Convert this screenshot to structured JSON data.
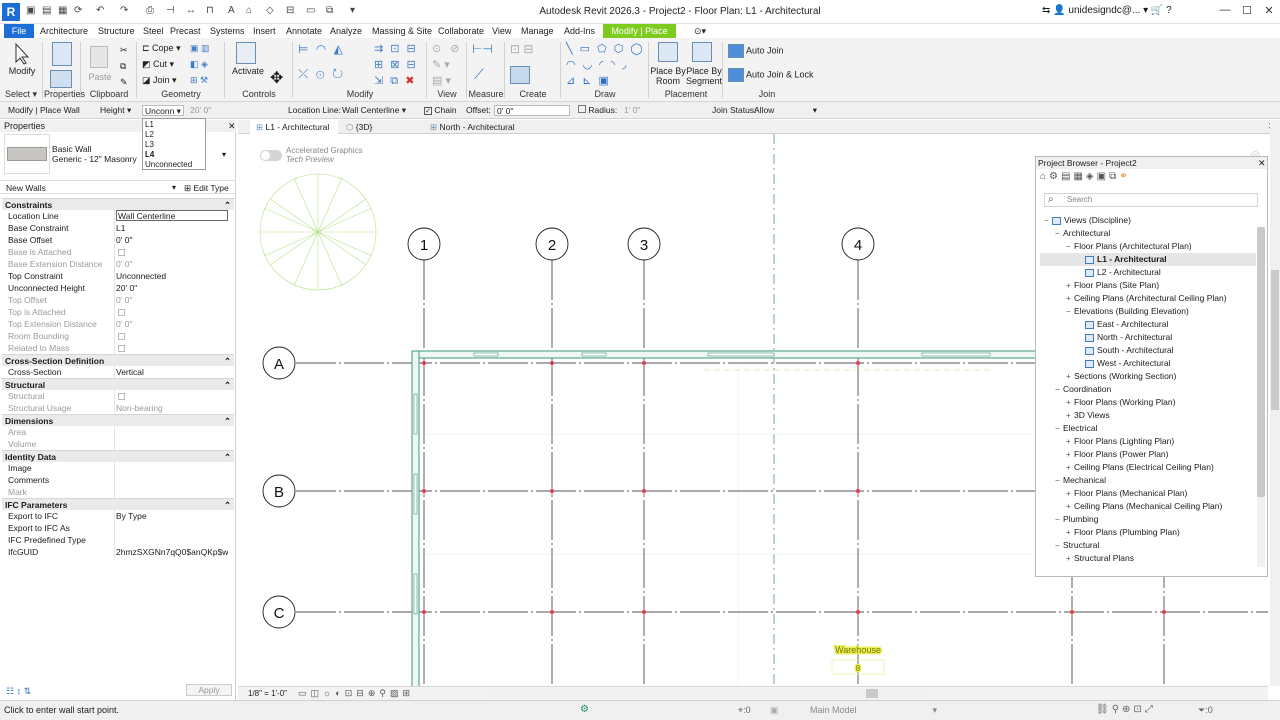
{
  "titlebar": {
    "logo": "R",
    "title": "Autodesk Revit 2026.3 - Project2 - Floor Plan: L1 - Architectural",
    "user": "unidesigndc@...",
    "help": "?"
  },
  "menu": {
    "file": "File",
    "tabs": [
      "Architecture",
      "Structure",
      "Steel",
      "Precast",
      "Systems",
      "Insert",
      "Annotate",
      "Analyze",
      "Massing & Site",
      "Collaborate",
      "View",
      "Manage",
      "Add-Ins"
    ],
    "context_tab": "Modify | Place Wall"
  },
  "ribbon": {
    "modify": "Modify",
    "paste": "Paste",
    "cope": "Cope",
    "cut": "Cut",
    "join": "Join",
    "activate": "Activate",
    "place_by_room": "Place By Room",
    "place_by_segment": "Place By Segment",
    "auto_join": "Auto Join",
    "auto_join_lock": "Auto Join & Lock",
    "panels": [
      "Select ▾",
      "Properties",
      "Clipboard",
      "Geometry",
      "Controls",
      "Modify",
      "View",
      "Measure",
      "Create",
      "Draw",
      "Placement",
      "Join"
    ]
  },
  "options_bar": {
    "context": "Modify | Place Wall",
    "height_mode": "Height",
    "height_target": "Unconn",
    "height_value": "20'  0\"",
    "location_line_label": "Location Line:",
    "location_line_value": "Wall Centerline",
    "chain": "Chain",
    "offset_label": "Offset:",
    "offset_value": "0'  0\"",
    "radius": "Radius:",
    "radius_value": "1'  0\"",
    "join_status_label": "Join Status:",
    "join_status_value": "Allow"
  },
  "dropdown": {
    "options": [
      "L1",
      "L2",
      "L3",
      "L4",
      "Unconnected"
    ],
    "selected": "L4"
  },
  "properties": {
    "header": "Properties",
    "type_family": "Basic Wall",
    "type_name": "Generic - 12\" Masonry",
    "instance_filter": "New Walls",
    "edit_type": "Edit Type",
    "apply": "Apply",
    "groups": [
      {
        "title": "Constraints",
        "rows": [
          {
            "name": "Location Line",
            "value": "Wall Centerline",
            "disabled": false
          },
          {
            "name": "Base Constraint",
            "value": "L1",
            "disabled": false
          },
          {
            "name": "Base Offset",
            "value": "0'  0\"",
            "disabled": false
          },
          {
            "name": "Base is Attached",
            "value": "",
            "disabled": true
          },
          {
            "name": "Base Extension Distance",
            "value": "0'  0\"",
            "disabled": true
          },
          {
            "name": "Top Constraint",
            "value": "Unconnected",
            "disabled": false
          },
          {
            "name": "Unconnected Height",
            "value": "20'  0\"",
            "disabled": false
          },
          {
            "name": "Top Offset",
            "value": "0'  0\"",
            "disabled": true
          },
          {
            "name": "Top is Attached",
            "value": "",
            "disabled": true
          },
          {
            "name": "Top Extension Distance",
            "value": "0'  0\"",
            "disabled": true
          },
          {
            "name": "Room Bounding",
            "value": "",
            "disabled": true
          },
          {
            "name": "Related to Mass",
            "value": "",
            "disabled": true
          }
        ]
      },
      {
        "title": "Cross-Section Definition",
        "rows": [
          {
            "name": "Cross-Section",
            "value": "Vertical",
            "disabled": false
          }
        ]
      },
      {
        "title": "Structural",
        "rows": [
          {
            "name": "Structural",
            "value": "",
            "disabled": true
          },
          {
            "name": "Structural Usage",
            "value": "Non-bearing",
            "disabled": true
          }
        ]
      },
      {
        "title": "Dimensions",
        "rows": [
          {
            "name": "Area",
            "value": "",
            "disabled": true
          },
          {
            "name": "Volume",
            "value": "",
            "disabled": true
          }
        ]
      },
      {
        "title": "Identity Data",
        "rows": [
          {
            "name": "Image",
            "value": "",
            "disabled": false
          },
          {
            "name": "Comments",
            "value": "",
            "disabled": false
          },
          {
            "name": "Mark",
            "value": "",
            "disabled": true
          }
        ]
      },
      {
        "title": "IFC Parameters",
        "rows": [
          {
            "name": "Export to IFC",
            "value": "By Type",
            "disabled": false
          },
          {
            "name": "Export to IFC As",
            "value": "",
            "disabled": false
          },
          {
            "name": "IFC Predefined Type",
            "value": "",
            "disabled": false
          },
          {
            "name": "IfcGUID",
            "value": "2hmzSXGNn7qQ0$anQKp$wb",
            "disabled": false
          }
        ]
      }
    ]
  },
  "view_tabs": [
    {
      "label": "L1 - Architectural",
      "active": true
    },
    {
      "label": "{3D}",
      "active": false
    },
    {
      "label": "North - Architectural",
      "active": false
    }
  ],
  "canvas": {
    "accel_title": "Accelerated Graphics",
    "accel_sub": "Tech Preview",
    "grid_numbers": [
      "1",
      "2",
      "3",
      "4"
    ],
    "grid_letters": [
      "A",
      "B",
      "C"
    ],
    "room_label": "Warehouse",
    "room_number": "8"
  },
  "project_browser": {
    "title": "Project Browser - Project2",
    "search_placeholder": "Search",
    "items": [
      {
        "label": "Views (Discipline)",
        "level": 0,
        "exp": "−",
        "icon": true,
        "sel": false
      },
      {
        "label": "Architectural",
        "level": 1,
        "exp": "−",
        "icon": false,
        "sel": false
      },
      {
        "label": "Floor Plans (Architectural Plan)",
        "level": 2,
        "exp": "−",
        "icon": false,
        "sel": false
      },
      {
        "label": "L1 - Architectural",
        "level": 3,
        "exp": "",
        "icon": true,
        "sel": true
      },
      {
        "label": "L2 - Architectural",
        "level": 3,
        "exp": "",
        "icon": true,
        "sel": false
      },
      {
        "label": "Floor Plans (Site Plan)",
        "level": 2,
        "exp": "+",
        "icon": false,
        "sel": false
      },
      {
        "label": "Ceiling Plans (Architectural Ceiling Plan)",
        "level": 2,
        "exp": "+",
        "icon": false,
        "sel": false
      },
      {
        "label": "Elevations (Building Elevation)",
        "level": 2,
        "exp": "−",
        "icon": false,
        "sel": false
      },
      {
        "label": "East - Architectural",
        "level": 3,
        "exp": "",
        "icon": true,
        "sel": false
      },
      {
        "label": "North - Architectural",
        "level": 3,
        "exp": "",
        "icon": true,
        "sel": false
      },
      {
        "label": "South - Architectural",
        "level": 3,
        "exp": "",
        "icon": true,
        "sel": false
      },
      {
        "label": "West - Architectural",
        "level": 3,
        "exp": "",
        "icon": true,
        "sel": false
      },
      {
        "label": "Sections (Working Section)",
        "level": 2,
        "exp": "+",
        "icon": false,
        "sel": false
      },
      {
        "label": "Coordination",
        "level": 1,
        "exp": "−",
        "icon": false,
        "sel": false
      },
      {
        "label": "Floor Plans (Working Plan)",
        "level": 2,
        "exp": "+",
        "icon": false,
        "sel": false
      },
      {
        "label": "3D Views",
        "level": 2,
        "exp": "+",
        "icon": false,
        "sel": false
      },
      {
        "label": "Electrical",
        "level": 1,
        "exp": "−",
        "icon": false,
        "sel": false
      },
      {
        "label": "Floor Plans (Lighting Plan)",
        "level": 2,
        "exp": "+",
        "icon": false,
        "sel": false
      },
      {
        "label": "Floor Plans (Power Plan)",
        "level": 2,
        "exp": "+",
        "icon": false,
        "sel": false
      },
      {
        "label": "Ceiling Plans (Electrical Ceiling Plan)",
        "level": 2,
        "exp": "+",
        "icon": false,
        "sel": false
      },
      {
        "label": "Mechanical",
        "level": 1,
        "exp": "−",
        "icon": false,
        "sel": false
      },
      {
        "label": "Floor Plans (Mechanical Plan)",
        "level": 2,
        "exp": "+",
        "icon": false,
        "sel": false
      },
      {
        "label": "Ceiling Plans (Mechanical Ceiling Plan)",
        "level": 2,
        "exp": "+",
        "icon": false,
        "sel": false
      },
      {
        "label": "Plumbing",
        "level": 1,
        "exp": "−",
        "icon": false,
        "sel": false
      },
      {
        "label": "Floor Plans (Plumbing Plan)",
        "level": 2,
        "exp": "+",
        "icon": false,
        "sel": false
      },
      {
        "label": "Structural",
        "level": 1,
        "exp": "−",
        "icon": false,
        "sel": false
      },
      {
        "label": "Structural Plans",
        "level": 2,
        "exp": "+",
        "icon": false,
        "sel": false
      }
    ]
  },
  "view_bar": {
    "scale": "1/8\" = 1'-0\""
  },
  "status_bar": {
    "message": "Click to enter wall start point.",
    "counter": ":0",
    "model": "Main Model",
    "filter": ":0"
  },
  "colors": {
    "accent": "#1c6ed6",
    "context": "#7ecb20",
    "gridline": "#d9434b",
    "wall": "#3d9a78"
  }
}
